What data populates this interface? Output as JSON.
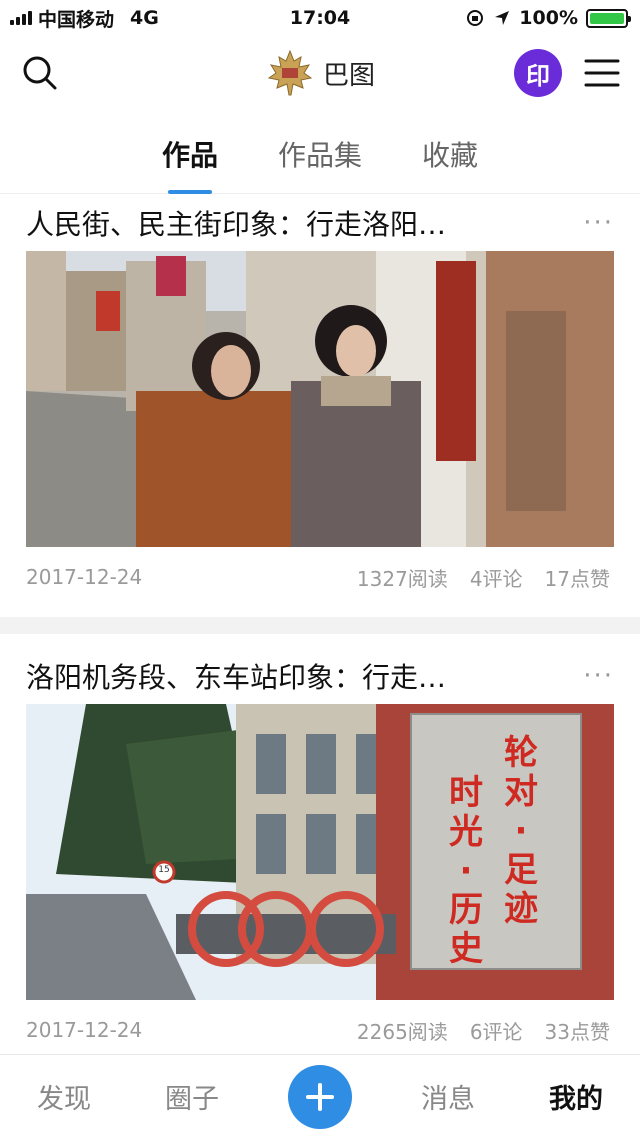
{
  "status_bar": {
    "carrier": "中国移动",
    "network": "4G",
    "time": "17:04",
    "battery": "100%",
    "battery_level": 1.0,
    "battery_color": "#33c748"
  },
  "header": {
    "title": "巴图",
    "avatar_text": "印",
    "avatar_color": "#6a2bd9",
    "icons": [
      "search-icon",
      "maple-leaf-logo",
      "menu-icon"
    ]
  },
  "tabs": [
    {
      "label": "作品",
      "active": true
    },
    {
      "label": "作品集",
      "active": false
    },
    {
      "label": "收藏",
      "active": false
    }
  ],
  "accent_color": "#2f8de4",
  "posts": [
    {
      "title": "人民街、民主街印象：行走洛阳…",
      "date": "2017-12-24",
      "reads": "1327阅读",
      "comments": "4评论",
      "likes": "17点赞",
      "more": "···"
    },
    {
      "title": "洛阳机务段、东车站印象：行走…",
      "date": "2017-12-24",
      "reads": "2265阅读",
      "comments": "6评论",
      "likes": "33点赞",
      "more": "···",
      "sign_text": [
        "轮对",
        "足迹",
        "时光",
        "历史"
      ],
      "speed_sign": "15"
    }
  ],
  "bottom_nav": [
    {
      "label": "发现",
      "active": false
    },
    {
      "label": "圈子",
      "active": false
    },
    {
      "label": "plus-icon",
      "active": false
    },
    {
      "label": "消息",
      "active": false
    },
    {
      "label": "我的",
      "active": true
    }
  ]
}
